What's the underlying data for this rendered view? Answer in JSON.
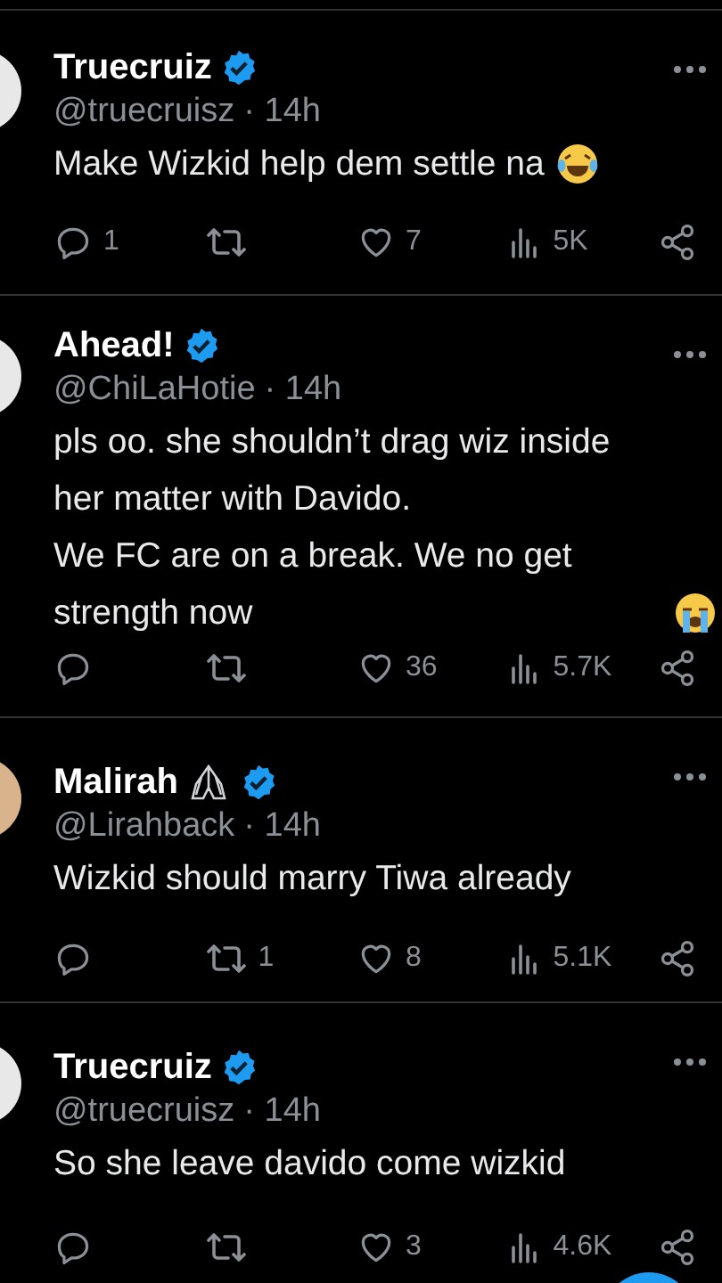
{
  "tweets": [
    {
      "name": "Truecruiz",
      "name_icon": false,
      "verified": true,
      "handle": "@truecruisz",
      "time": "· 14h",
      "text": "Make Wizkid help dem settle na",
      "emoji": {
        "kind": "tears-of-joy"
      },
      "actions": [
        {
          "kind": "reply",
          "count": "1"
        },
        {
          "kind": "repost"
        },
        {
          "kind": "like",
          "count": "7"
        },
        {
          "kind": "views",
          "count": "5K"
        },
        {
          "kind": "share"
        }
      ]
    },
    {
      "name": "Ahead!",
      "name_icon": false,
      "verified": true,
      "handle": "@ChiLaHotie",
      "time": "· 14h",
      "text": "pls oo. she shouldn’t drag wiz inside her matter with Davido.\nWe FC are on a break. We no get strength  now",
      "emoji": {
        "kind": "crying"
      },
      "actions": [
        {
          "kind": "reply"
        },
        {
          "kind": "repost"
        },
        {
          "kind": "like",
          "count": "36"
        },
        {
          "kind": "views",
          "count": "5.7K"
        },
        {
          "kind": "share"
        }
      ]
    },
    {
      "name": "Malirah",
      "name_icon": true,
      "verified": true,
      "handle": "@Lirahback",
      "time": "· 14h",
      "text": "Wizkid should marry Tiwa already",
      "actions": [
        {
          "kind": "reply"
        },
        {
          "kind": "repost",
          "count": "1"
        },
        {
          "kind": "like",
          "count": "8"
        },
        {
          "kind": "views",
          "count": "5.1K"
        },
        {
          "kind": "share"
        }
      ]
    },
    {
      "name": "Truecruiz",
      "name_icon": false,
      "verified": true,
      "handle": "@truecruisz",
      "time": "· 14h",
      "text": "So she leave davido come wizkid",
      "actions": [
        {
          "kind": "reply"
        },
        {
          "kind": "repost"
        },
        {
          "kind": "like",
          "count": "3"
        },
        {
          "kind": "views",
          "count": "4.6K"
        },
        {
          "kind": "share"
        }
      ]
    }
  ]
}
